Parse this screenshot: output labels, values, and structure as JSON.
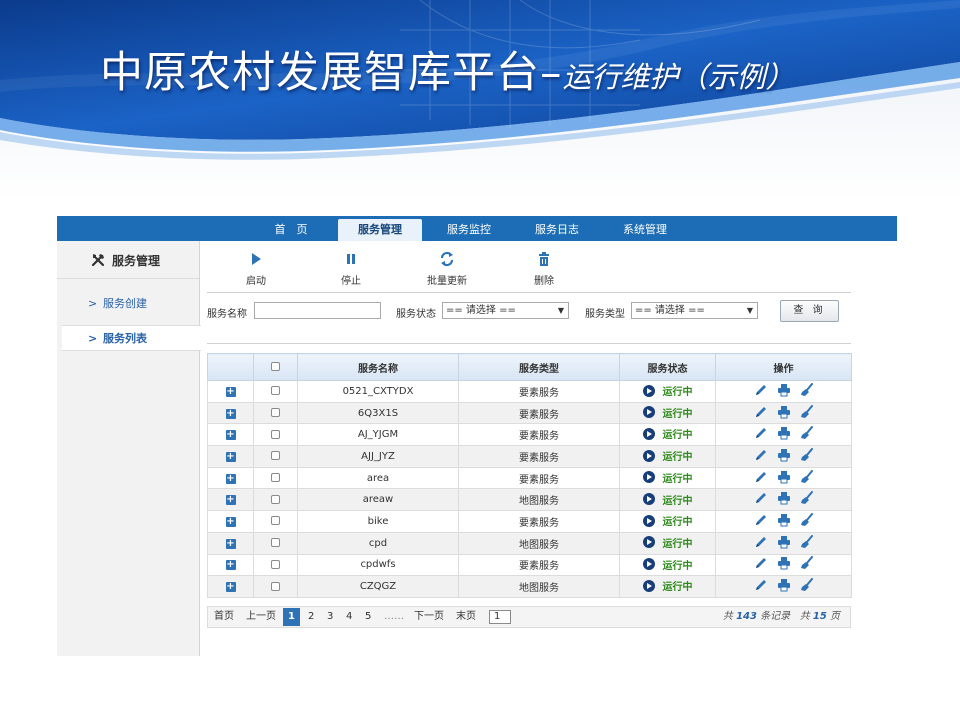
{
  "slide": {
    "title_main": "中原农村发展智库平台",
    "title_dash": "–",
    "title_sub": "运行维护（示例）"
  },
  "colors": {
    "nav_blue": "#1c6db5",
    "status_green": "#2f8a1c",
    "accent_blue": "#2e73b5"
  },
  "nav": {
    "tabs": [
      {
        "label": "首　页",
        "active": false
      },
      {
        "label": "服务管理",
        "active": true
      },
      {
        "label": "服务监控",
        "active": false
      },
      {
        "label": "服务日志",
        "active": false
      },
      {
        "label": "系统管理",
        "active": false
      }
    ]
  },
  "sidebar": {
    "header_icon": "tools-icon",
    "header": "服务管理",
    "items": [
      {
        "label": "服务创建",
        "active": false
      },
      {
        "label": "服务列表",
        "active": true
      }
    ]
  },
  "toolbar": {
    "start": {
      "label": "启动",
      "icon": "play-icon"
    },
    "stop": {
      "label": "停止",
      "icon": "pause-icon"
    },
    "batch_update": {
      "label": "批量更新",
      "icon": "refresh-icon"
    },
    "delete": {
      "label": "删除",
      "icon": "trash-icon"
    }
  },
  "filters": {
    "name_label": "服务名称",
    "name_value": "",
    "status_label": "服务状态",
    "status_value": "== 请选择 ==",
    "type_label": "服务类型",
    "type_value": "== 请选择 ==",
    "query_label": "查 询"
  },
  "table": {
    "headers": {
      "name": "服务名称",
      "type": "服务类型",
      "status": "服务状态",
      "ops": "操作"
    },
    "rows": [
      {
        "name": "0521_CXTYDX",
        "type": "要素服务",
        "status": "运行中"
      },
      {
        "name": "6Q3X1S",
        "type": "要素服务",
        "status": "运行中"
      },
      {
        "name": "AJ_YJGM",
        "type": "要素服务",
        "status": "运行中"
      },
      {
        "name": "AJJ_JYZ",
        "type": "要素服务",
        "status": "运行中"
      },
      {
        "name": "area",
        "type": "要素服务",
        "status": "运行中"
      },
      {
        "name": "areaw",
        "type": "地图服务",
        "status": "运行中"
      },
      {
        "name": "bike",
        "type": "要素服务",
        "status": "运行中"
      },
      {
        "name": "cpd",
        "type": "地图服务",
        "status": "运行中"
      },
      {
        "name": "cpdwfs",
        "type": "要素服务",
        "status": "运行中"
      },
      {
        "name": "CZQGZ",
        "type": "地图服务",
        "status": "运行中"
      }
    ],
    "row_icons": [
      "plus-icon",
      "checkbox",
      "play-circle-icon",
      "pencil-icon",
      "printer-icon",
      "broom-icon"
    ]
  },
  "pager": {
    "first": "首页",
    "prev": "上一页",
    "pages": [
      "1",
      "2",
      "3",
      "4",
      "5"
    ],
    "current": "1",
    "ellipsis": "……",
    "next": "下一页",
    "last": "末页",
    "goto_value": "1",
    "total_prefix": "共",
    "total_records": "143",
    "records_suffix": "条记录",
    "total_pages": "15",
    "pages_suffix": "页"
  }
}
